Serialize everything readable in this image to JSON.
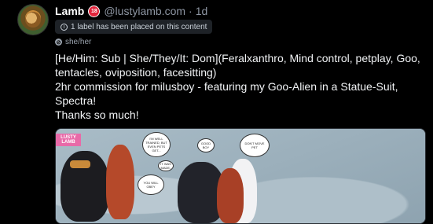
{
  "post": {
    "author_name": "Lamb",
    "age_badge": "18",
    "handle": "@lustylamb.com",
    "separator": "·",
    "time_ago": "1d",
    "label_notice": "1 label has been placed on this content",
    "pronouns": "she/her",
    "body_lines": [
      "[He/Him: Sub | She/They/It: Dom](Feralxanthro, Mind control, petplay, Goo, tentacles, oviposition, facesitting)",
      "2hr commission for milusboy - featuring my Goo-Alien in a Statue-Suit, Spectra!",
      "Thanks so much!"
    ]
  },
  "media": {
    "logo_text": [
      "LUSTY",
      "LAMB"
    ],
    "bubbles": [
      "I'M WELL TRAINED, BUT EVEN PETS GET...",
      "YOU WILL OBEY",
      "IT WAS MADE-",
      "GOOD BOY",
      "DON'T MOVE PET"
    ]
  },
  "colors": {
    "background": "#000000",
    "text": "#f1f3f5",
    "muted": "#8e96a3",
    "badge_red": "#e0243b",
    "pill_bg": "#1e2227"
  }
}
